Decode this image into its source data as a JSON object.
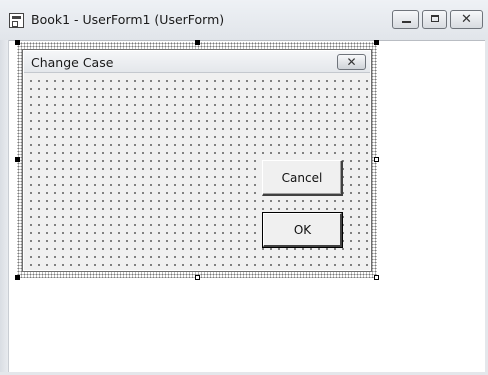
{
  "window": {
    "title": "Book1 - UserForm1 (UserForm)",
    "app_icon": "userform-icon",
    "controls": {
      "minimize_icon": "minimize-icon",
      "maximize_icon": "maximize-icon",
      "close_glyph": "✕"
    }
  },
  "userform": {
    "caption": "Change Case",
    "close_glyph": "✕",
    "buttons": [
      {
        "id": "cancel",
        "label": "Cancel"
      },
      {
        "id": "ok",
        "label": "OK"
      }
    ]
  },
  "colors": {
    "form_background": "#f0f0f0",
    "selection_handle": "#000000"
  }
}
